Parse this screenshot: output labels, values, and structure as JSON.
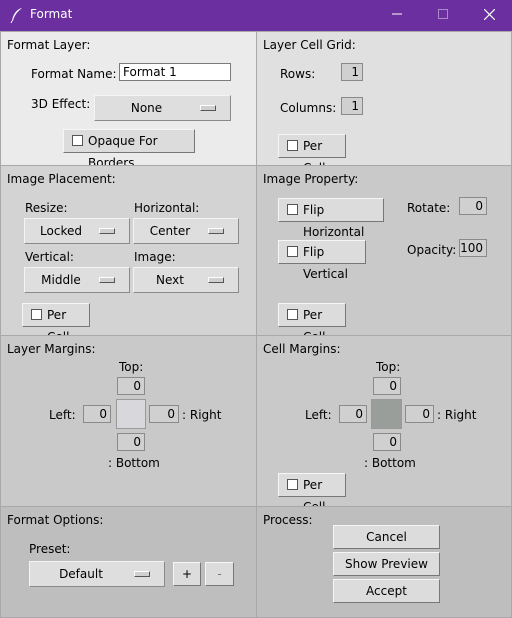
{
  "window": {
    "title": "Format",
    "icon": "feather-icon"
  },
  "format_layer": {
    "title": "Format Layer:",
    "name_label": "Format Name:",
    "name_value": "Format 1",
    "effect_label": "3D Effect:",
    "effect_value": "None",
    "opaque_label": "Opaque For Borders"
  },
  "cell_grid": {
    "title": "Layer Cell Grid:",
    "rows_label": "Rows:",
    "rows_value": "1",
    "columns_label": "Columns:",
    "columns_value": "1",
    "per_cell": "Per Cell"
  },
  "image_placement": {
    "title": "Image Placement:",
    "resize_label": "Resize:",
    "resize_value": "Locked",
    "horizontal_label": "Horizontal:",
    "horizontal_value": "Center",
    "vertical_label": "Vertical:",
    "vertical_value": "Middle",
    "image_label": "Image:",
    "image_value": "Next",
    "per_cell": "Per Cell"
  },
  "image_property": {
    "title": "Image Property:",
    "flip_h": "Flip Horizontal",
    "flip_v": "Flip Vertical",
    "rotate_label": "Rotate:",
    "rotate_value": "0",
    "opacity_label": "Opacity:",
    "opacity_value": "100",
    "per_cell": "Per Cell"
  },
  "layer_margins": {
    "title": "Layer Margins:",
    "top_label": "Top:",
    "top_value": "0",
    "left_label": "Left:",
    "left_value": "0",
    "right_label": ": Right",
    "right_value": "0",
    "bottom_label": ": Bottom",
    "bottom_value": "0",
    "swatch_color": "#d8d8dc"
  },
  "cell_margins": {
    "title": "Cell Margins:",
    "top_label": "Top:",
    "top_value": "0",
    "left_label": "Left:",
    "left_value": "0",
    "right_label": ": Right",
    "right_value": "0",
    "bottom_label": ": Bottom",
    "bottom_value": "0",
    "swatch_color": "#9a9e9a",
    "per_cell": "Per Cell"
  },
  "format_options": {
    "title": "Format Options:",
    "preset_label": "Preset:",
    "preset_value": "Default",
    "add": "+",
    "remove": "-"
  },
  "process": {
    "title": "Process:",
    "cancel": "Cancel",
    "preview": "Show Preview",
    "accept": "Accept"
  }
}
